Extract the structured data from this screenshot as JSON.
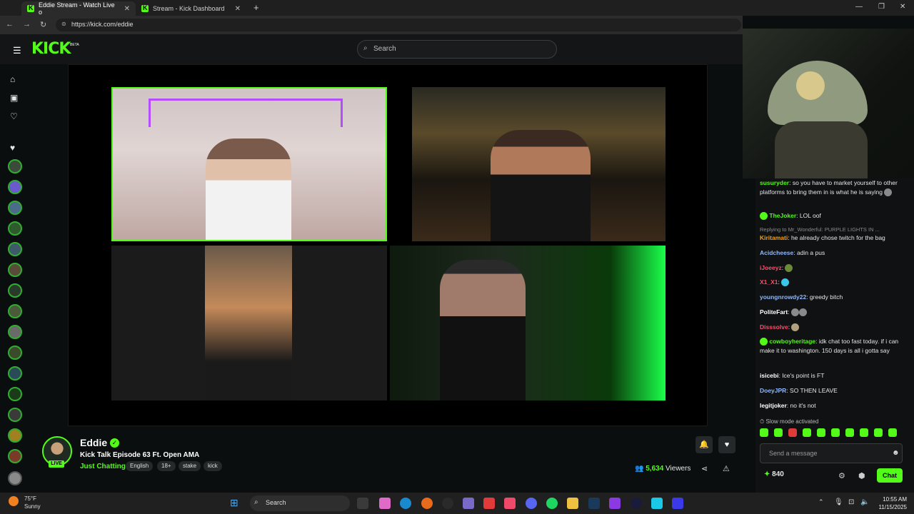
{
  "browser": {
    "tabs": [
      {
        "label": "Eddie Stream - Watch Live o",
        "active": true
      },
      {
        "label": "Stream - Kick Dashboard",
        "active": false
      }
    ],
    "url": "https://kick.com/eddie",
    "new_tab_symbol": "+"
  },
  "kick": {
    "logo": "KICK",
    "beta": "BETA",
    "search_placeholder": "Search",
    "accent": "#53fc18"
  },
  "stream": {
    "streamer": "Eddie",
    "live_badge": "LIVE",
    "title": "Kick Talk Episode 63 Ft. Open AMA",
    "category": "Just Chatting",
    "tags": [
      "English",
      "18+",
      "stake",
      "kick"
    ],
    "viewers_count": "5,634",
    "viewers_label": "Viewers"
  },
  "chat": {
    "messages": [
      {
        "user": "susuryder",
        "color": "#53fc18",
        "text": ": so you have to market yourself to other platforms to bring them in is what he is saying"
      },
      {
        "user": "TheJoker",
        "color": "#53fc18",
        "text": ": LOL oof"
      },
      {
        "reply": "Replying to Mr_Wonderful: PURPLE LIGHTS IN ...",
        "user": "Kiritamati",
        "color": "#f0a020",
        "text": ": he already chose twitch for the bag"
      },
      {
        "user": "Acidcheese",
        "color": "#8fb8ff",
        "text": ": adin a pus"
      },
      {
        "user": "iJoeeyz",
        "color": "#ff4d6d",
        "text": ": "
      },
      {
        "user": "X1_X1",
        "color": "#ff4d6d",
        "text": ": "
      },
      {
        "user": "youngnrowdy22",
        "color": "#8fb8ff",
        "text": ": greedy bitch"
      },
      {
        "user": "PoliteFart",
        "color": "#ffffff",
        "text": ": "
      },
      {
        "user": "Disssolve",
        "color": "#ff4d6d",
        "text": ": "
      },
      {
        "user": "cowboyheritage",
        "color": "#53fc18",
        "text": ": idk chat too fast today. if i can make it to washington. 150 days is all i gotta say"
      },
      {
        "user": "isicebi",
        "color": "#ffffff",
        "text": ": Ice's point is FT"
      },
      {
        "user": "DoeyJPR",
        "color": "#8fb8ff",
        "text": ": SO THEN LEAVE"
      },
      {
        "user": "legitjoker",
        "color": "#ffffff",
        "text": ": no it's not"
      }
    ],
    "slow_mode": "Slow mode activated",
    "input_placeholder": "Send a message",
    "points": "840",
    "send_label": "Chat"
  },
  "taskbar": {
    "temp": "75°F",
    "condition": "Sunny",
    "search": "Search",
    "time": "10:55 AM",
    "date": "11/15/2025"
  }
}
